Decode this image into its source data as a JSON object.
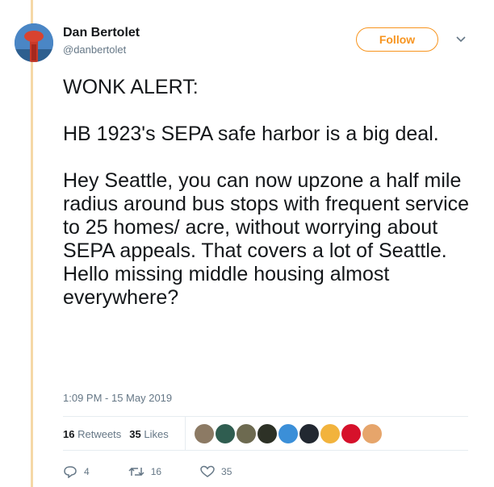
{
  "user": {
    "name": "Dan Bertolet",
    "handle": "@danbertolet"
  },
  "follow_label": "Follow",
  "tweet": {
    "text": "WONK ALERT:\n\nHB 1923's SEPA safe harbor is a big deal.\n\nHey Seattle, you can now upzone a half mile radius around bus stops with frequent service to 25 homes/ acre, without worrying about SEPA appeals. That covers a lot of Seattle. Hello missing middle housing almost everywhere?",
    "timestamp": "1:09 PM - 15 May 2019"
  },
  "stats": {
    "retweets_count": "16",
    "retweets_label": "Retweets",
    "likes_count": "35",
    "likes_label": "Likes"
  },
  "liker_avatar_colors": [
    "#8c7a64",
    "#2f5d50",
    "#6d6a50",
    "#2d3126",
    "#3b8fd8",
    "#222831",
    "#f2b33d",
    "#d6112b",
    "#e6a56b"
  ],
  "actions": {
    "reply_count": "4",
    "retweet_count": "16",
    "like_count": "35"
  },
  "colors": {
    "accent": "#f7941e",
    "thread_line": "#f5d8a6",
    "muted": "#657786"
  },
  "icons": {
    "reply": "reply-icon",
    "retweet": "retweet-icon",
    "like": "heart-icon",
    "more": "chevron-down-icon"
  }
}
